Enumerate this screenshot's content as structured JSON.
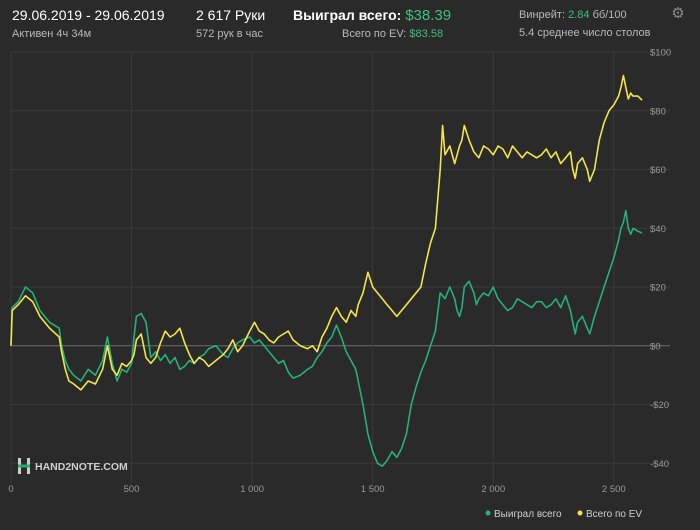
{
  "header": {
    "date_range": "29.06.2019 - 29.06.2019",
    "active": "Активен 4ч 34м",
    "hands": "2 617 Руки",
    "hands_per_hour": "572 рук в час",
    "won_total_label": "Выиграл всего:",
    "won_total_value": "$38.39",
    "ev_label": "Всего по EV:",
    "ev_value": "$83.58",
    "winrate_label": "Винрейт:",
    "winrate_value": "2.84",
    "winrate_unit": "бб/100",
    "avg_tables": "5.4 среднее число столов",
    "settings_icon": "gear-icon"
  },
  "logo": {
    "text": "HAND2NOTE.COM"
  },
  "colors": {
    "won": "#27b07a",
    "ev": "#f2e64a",
    "bg": "#2a2a2a",
    "grid": "#3a3a3a",
    "zero": "#6e6e6e",
    "accent": "#3fbf7f"
  },
  "chart_data": {
    "type": "line",
    "xlim": [
      0,
      2617
    ],
    "ylim": [
      -45,
      100
    ],
    "x_ticks": [
      0,
      500,
      1000,
      1500,
      2000,
      2500
    ],
    "x_tick_labels": [
      "0",
      "500",
      "1 000",
      "1 500",
      "2 000",
      "2 500"
    ],
    "y_ticks": [
      100,
      80,
      60,
      40,
      20,
      0,
      -20,
      -40
    ],
    "y_tick_labels": [
      "$100",
      "$80",
      "$60",
      "$40",
      "$20",
      "$0",
      "-$20",
      "-$40"
    ],
    "legend_position": "bottom-right",
    "series": [
      {
        "name": "Выиграл всего",
        "color": "#27b07a",
        "points": [
          [
            0,
            0
          ],
          [
            5,
            13
          ],
          [
            30,
            15
          ],
          [
            60,
            20
          ],
          [
            90,
            18
          ],
          [
            120,
            12
          ],
          [
            160,
            8
          ],
          [
            200,
            6
          ],
          [
            210,
            0
          ],
          [
            225,
            -5
          ],
          [
            240,
            -8
          ],
          [
            260,
            -10
          ],
          [
            290,
            -12
          ],
          [
            320,
            -8
          ],
          [
            350,
            -10
          ],
          [
            380,
            -5
          ],
          [
            400,
            3
          ],
          [
            420,
            -6
          ],
          [
            440,
            -12
          ],
          [
            460,
            -8
          ],
          [
            480,
            -9
          ],
          [
            500,
            -6
          ],
          [
            510,
            3
          ],
          [
            520,
            10
          ],
          [
            540,
            11
          ],
          [
            560,
            8
          ],
          [
            580,
            -4
          ],
          [
            600,
            -2
          ],
          [
            620,
            -5
          ],
          [
            640,
            -3
          ],
          [
            660,
            -6
          ],
          [
            680,
            -4
          ],
          [
            700,
            -8
          ],
          [
            720,
            -7
          ],
          [
            740,
            -5
          ],
          [
            760,
            -6
          ],
          [
            780,
            -4
          ],
          [
            800,
            -3
          ],
          [
            820,
            -1
          ],
          [
            850,
            0
          ],
          [
            880,
            -3
          ],
          [
            900,
            -4
          ],
          [
            920,
            -1
          ],
          [
            940,
            1
          ],
          [
            960,
            2
          ],
          [
            990,
            3
          ],
          [
            1010,
            1
          ],
          [
            1030,
            2
          ],
          [
            1050,
            0
          ],
          [
            1070,
            -2
          ],
          [
            1090,
            -4
          ],
          [
            1110,
            -6
          ],
          [
            1130,
            -5
          ],
          [
            1150,
            -9
          ],
          [
            1170,
            -11
          ],
          [
            1200,
            -10
          ],
          [
            1230,
            -8
          ],
          [
            1250,
            -7
          ],
          [
            1270,
            -4
          ],
          [
            1290,
            -2
          ],
          [
            1310,
            1
          ],
          [
            1330,
            3
          ],
          [
            1350,
            7
          ],
          [
            1370,
            3
          ],
          [
            1390,
            -2
          ],
          [
            1410,
            -5
          ],
          [
            1430,
            -8
          ],
          [
            1440,
            -12
          ],
          [
            1460,
            -20
          ],
          [
            1480,
            -30
          ],
          [
            1500,
            -36
          ],
          [
            1520,
            -40
          ],
          [
            1540,
            -41
          ],
          [
            1560,
            -39
          ],
          [
            1580,
            -36
          ],
          [
            1600,
            -38
          ],
          [
            1620,
            -35
          ],
          [
            1640,
            -30
          ],
          [
            1660,
            -20
          ],
          [
            1680,
            -14
          ],
          [
            1700,
            -9
          ],
          [
            1720,
            -5
          ],
          [
            1740,
            0
          ],
          [
            1760,
            5
          ],
          [
            1780,
            18
          ],
          [
            1790,
            17
          ],
          [
            1800,
            16
          ],
          [
            1820,
            20
          ],
          [
            1840,
            16
          ],
          [
            1850,
            12
          ],
          [
            1860,
            10
          ],
          [
            1870,
            13
          ],
          [
            1880,
            20
          ],
          [
            1900,
            22
          ],
          [
            1920,
            18
          ],
          [
            1930,
            14
          ],
          [
            1940,
            16
          ],
          [
            1960,
            18
          ],
          [
            1980,
            17
          ],
          [
            2000,
            20
          ],
          [
            2020,
            16
          ],
          [
            2040,
            14
          ],
          [
            2060,
            12
          ],
          [
            2080,
            13
          ],
          [
            2100,
            16
          ],
          [
            2120,
            15
          ],
          [
            2140,
            14
          ],
          [
            2160,
            13
          ],
          [
            2180,
            15
          ],
          [
            2200,
            15
          ],
          [
            2220,
            13
          ],
          [
            2240,
            14
          ],
          [
            2260,
            16
          ],
          [
            2280,
            13
          ],
          [
            2300,
            17
          ],
          [
            2320,
            12
          ],
          [
            2330,
            8
          ],
          [
            2340,
            4
          ],
          [
            2350,
            8
          ],
          [
            2370,
            10
          ],
          [
            2390,
            6
          ],
          [
            2400,
            4
          ],
          [
            2420,
            10
          ],
          [
            2440,
            15
          ],
          [
            2460,
            20
          ],
          [
            2480,
            25
          ],
          [
            2500,
            30
          ],
          [
            2520,
            36
          ],
          [
            2530,
            40
          ],
          [
            2540,
            42
          ],
          [
            2550,
            46
          ],
          [
            2560,
            40
          ],
          [
            2570,
            38
          ],
          [
            2580,
            40
          ],
          [
            2600,
            39
          ],
          [
            2617,
            38.39
          ]
        ]
      },
      {
        "name": "Всего по EV",
        "color": "#f2e64a",
        "points": [
          [
            0,
            0
          ],
          [
            5,
            12
          ],
          [
            30,
            14
          ],
          [
            60,
            17
          ],
          [
            90,
            15
          ],
          [
            120,
            10
          ],
          [
            160,
            6
          ],
          [
            200,
            3
          ],
          [
            210,
            -2
          ],
          [
            225,
            -8
          ],
          [
            240,
            -12
          ],
          [
            260,
            -13
          ],
          [
            290,
            -15
          ],
          [
            320,
            -12
          ],
          [
            350,
            -13
          ],
          [
            380,
            -8
          ],
          [
            400,
            0
          ],
          [
            420,
            -8
          ],
          [
            440,
            -10
          ],
          [
            460,
            -6
          ],
          [
            480,
            -7
          ],
          [
            500,
            -5
          ],
          [
            510,
            -3
          ],
          [
            520,
            2
          ],
          [
            540,
            4
          ],
          [
            560,
            -4
          ],
          [
            580,
            -6
          ],
          [
            600,
            -4
          ],
          [
            620,
            1
          ],
          [
            640,
            5
          ],
          [
            660,
            3
          ],
          [
            680,
            4
          ],
          [
            700,
            6
          ],
          [
            720,
            1
          ],
          [
            740,
            -3
          ],
          [
            760,
            -6
          ],
          [
            780,
            -4
          ],
          [
            800,
            -5
          ],
          [
            820,
            -7
          ],
          [
            850,
            -5
          ],
          [
            880,
            -3
          ],
          [
            900,
            -1
          ],
          [
            920,
            2
          ],
          [
            940,
            -2
          ],
          [
            960,
            0
          ],
          [
            990,
            5
          ],
          [
            1010,
            8
          ],
          [
            1030,
            5
          ],
          [
            1050,
            4
          ],
          [
            1070,
            2
          ],
          [
            1090,
            1
          ],
          [
            1110,
            3
          ],
          [
            1130,
            4
          ],
          [
            1150,
            5
          ],
          [
            1170,
            2
          ],
          [
            1200,
            0
          ],
          [
            1230,
            -1
          ],
          [
            1250,
            0
          ],
          [
            1270,
            -2
          ],
          [
            1290,
            3
          ],
          [
            1310,
            6
          ],
          [
            1330,
            10
          ],
          [
            1350,
            13
          ],
          [
            1370,
            10
          ],
          [
            1390,
            8
          ],
          [
            1410,
            12
          ],
          [
            1430,
            10
          ],
          [
            1440,
            14
          ],
          [
            1460,
            18
          ],
          [
            1480,
            25
          ],
          [
            1500,
            20
          ],
          [
            1520,
            18
          ],
          [
            1540,
            16
          ],
          [
            1560,
            14
          ],
          [
            1580,
            12
          ],
          [
            1600,
            10
          ],
          [
            1620,
            12
          ],
          [
            1640,
            14
          ],
          [
            1660,
            16
          ],
          [
            1680,
            18
          ],
          [
            1700,
            20
          ],
          [
            1720,
            28
          ],
          [
            1740,
            35
          ],
          [
            1760,
            40
          ],
          [
            1780,
            60
          ],
          [
            1790,
            75
          ],
          [
            1800,
            65
          ],
          [
            1820,
            68
          ],
          [
            1840,
            62
          ],
          [
            1850,
            65
          ],
          [
            1860,
            68
          ],
          [
            1870,
            70
          ],
          [
            1880,
            75
          ],
          [
            1900,
            70
          ],
          [
            1920,
            66
          ],
          [
            1940,
            64
          ],
          [
            1960,
            68
          ],
          [
            1980,
            67
          ],
          [
            2000,
            65
          ],
          [
            2020,
            68
          ],
          [
            2040,
            67
          ],
          [
            2060,
            64
          ],
          [
            2080,
            68
          ],
          [
            2100,
            66
          ],
          [
            2120,
            64
          ],
          [
            2140,
            66
          ],
          [
            2160,
            65
          ],
          [
            2180,
            64
          ],
          [
            2200,
            65
          ],
          [
            2220,
            67
          ],
          [
            2240,
            64
          ],
          [
            2260,
            66
          ],
          [
            2280,
            62
          ],
          [
            2300,
            64
          ],
          [
            2320,
            66
          ],
          [
            2330,
            60
          ],
          [
            2340,
            57
          ],
          [
            2350,
            62
          ],
          [
            2370,
            64
          ],
          [
            2390,
            60
          ],
          [
            2400,
            56
          ],
          [
            2420,
            60
          ],
          [
            2440,
            70
          ],
          [
            2460,
            76
          ],
          [
            2480,
            80
          ],
          [
            2500,
            82
          ],
          [
            2520,
            85
          ],
          [
            2530,
            88
          ],
          [
            2540,
            92
          ],
          [
            2550,
            88
          ],
          [
            2560,
            84
          ],
          [
            2570,
            86
          ],
          [
            2580,
            85
          ],
          [
            2600,
            85
          ],
          [
            2617,
            83.58
          ]
        ]
      }
    ]
  }
}
